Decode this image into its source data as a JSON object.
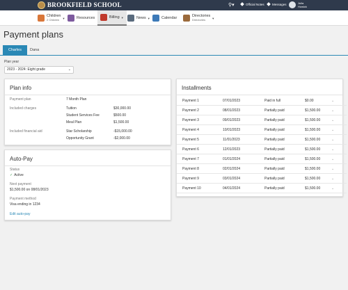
{
  "header": {
    "school_name": "BROOKFIELD SCHOOL",
    "links": [
      {
        "label": "Official Notes",
        "icon": "diamond-icon"
      },
      {
        "label": "Messages",
        "icon": "diamond-icon"
      }
    ],
    "user": {
      "first": "Julia",
      "last": "Howick"
    }
  },
  "nav": {
    "items": [
      {
        "label": "Children",
        "sub": "2 Children",
        "icon": "children-icon",
        "active": false
      },
      {
        "label": "Resources",
        "icon": "resources-icon",
        "active": false
      },
      {
        "label": "Billing",
        "icon": "billing-icon",
        "active": true
      },
      {
        "label": "News",
        "icon": "news-icon",
        "active": false
      },
      {
        "label": "Calendar",
        "icon": "calendar-icon",
        "active": false
      },
      {
        "label": "Directories",
        "sub": "Directories",
        "icon": "directories-icon",
        "active": false
      }
    ]
  },
  "page": {
    "title": "Payment plans",
    "tabs": [
      {
        "label": "Charles",
        "active": true
      },
      {
        "label": "Dana",
        "active": false
      }
    ],
    "plan_year": {
      "label": "Plan year",
      "value": "2023 - 2024: Eight grade"
    }
  },
  "plan_info": {
    "title": "Plan info",
    "payment_plan_label": "Payment plan",
    "payment_plan_value": "7 Month Plan",
    "charges_label": "Included charges",
    "charges": [
      {
        "name": "Tuition",
        "amount": "$30,000.00"
      },
      {
        "name": "Student Services Fee",
        "amount": "$500.00"
      },
      {
        "name": "Meal Plan",
        "amount": "$1,500.00"
      }
    ],
    "aid_label": "Included financial aid",
    "aid": [
      {
        "name": "Star Scholarship",
        "amount": "-$15,000.00"
      },
      {
        "name": "Opportunity Grant",
        "amount": "-$2,000.00"
      }
    ]
  },
  "autopay": {
    "title": "Auto-Pay",
    "status_label": "Status",
    "status_value": "Active",
    "next_payment_label": "Next payment",
    "next_payment_value": "$1,500.00 on 08/01/2023",
    "method_label": "Payment method",
    "method_value": "Visa ending in 1234",
    "edit_link": "Edit auto-pay"
  },
  "installments": {
    "title": "Installments",
    "rows": [
      {
        "name": "Payment 1",
        "date": "07/01/2023",
        "status": "Paid in full",
        "amount": "$0.00"
      },
      {
        "name": "Payment 2",
        "date": "08/01/2023",
        "status": "Partially paid",
        "amount": "$1,500.00"
      },
      {
        "name": "Payment 3",
        "date": "09/01/2023",
        "status": "Partially paid",
        "amount": "$1,500.00"
      },
      {
        "name": "Payment 4",
        "date": "10/01/2023",
        "status": "Partially paid",
        "amount": "$1,500.00"
      },
      {
        "name": "Payment 5",
        "date": "11/01/2023",
        "status": "Partially paid",
        "amount": "$1,500.00"
      },
      {
        "name": "Payment 6",
        "date": "12/01/2023",
        "status": "Partially paid",
        "amount": "$1,500.00"
      },
      {
        "name": "Payment 7",
        "date": "01/01/2024",
        "status": "Partially paid",
        "amount": "$1,500.00"
      },
      {
        "name": "Payment 8",
        "date": "02/01/2024",
        "status": "Partially paid",
        "amount": "$1,500.00"
      },
      {
        "name": "Payment 9",
        "date": "03/01/2024",
        "status": "Partially paid",
        "amount": "$1,500.00"
      },
      {
        "name": "Payment 10",
        "date": "04/01/2024",
        "status": "Partially paid",
        "amount": "$1,500.00"
      }
    ]
  },
  "colors": {
    "header_bg": "#2f3a4c",
    "accent": "#2a88b5",
    "success": "#3a9a4a"
  }
}
